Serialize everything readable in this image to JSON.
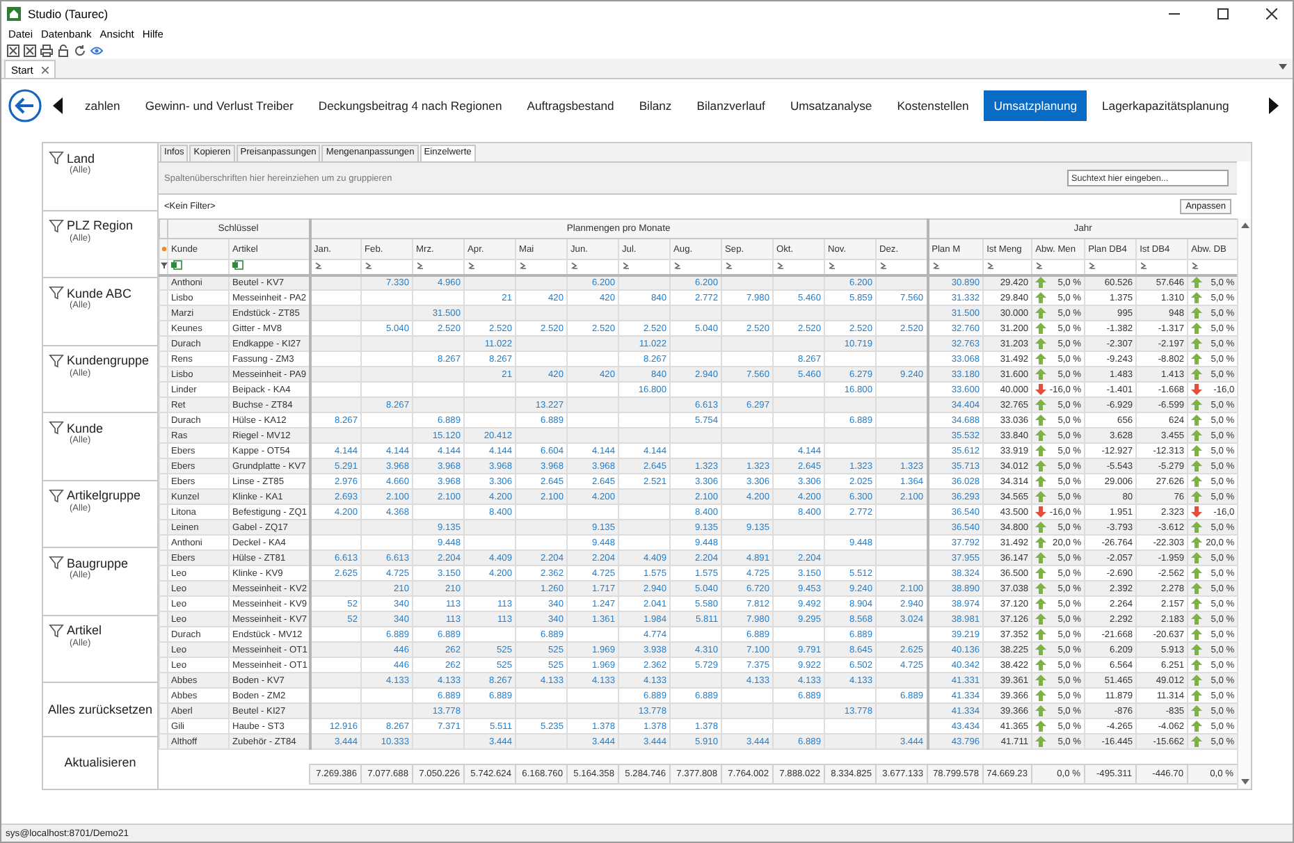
{
  "window": {
    "title": "Studio (Taurec)"
  },
  "menu": [
    "Datei",
    "Datenbank",
    "Ansicht",
    "Hilfe"
  ],
  "doc_tabs": [
    {
      "label": "Start",
      "selected": true
    }
  ],
  "nav_tabs": [
    {
      "label": "zahlen",
      "selected": false
    },
    {
      "label": "Gewinn- und Verlust Treiber",
      "selected": false
    },
    {
      "label": "Deckungsbeitrag 4 nach Regionen",
      "selected": false
    },
    {
      "label": "Auftragsbestand",
      "selected": false
    },
    {
      "label": "Bilanz",
      "selected": false
    },
    {
      "label": "Bilanzverlauf",
      "selected": false
    },
    {
      "label": "Umsatzanalyse",
      "selected": false
    },
    {
      "label": "Kostenstellen",
      "selected": false
    },
    {
      "label": "Umsatzplanung",
      "selected": true
    },
    {
      "label": "Lagerkapazitätsplanung",
      "selected": false
    }
  ],
  "filters": [
    {
      "label": "Land",
      "value": "(Alle)"
    },
    {
      "label": "PLZ Region",
      "value": "(Alle)"
    },
    {
      "label": "Kunde ABC",
      "value": "(Alle)"
    },
    {
      "label": "Kundengruppe",
      "value": "(Alle)"
    },
    {
      "label": "Kunde",
      "value": "(Alle)"
    },
    {
      "label": "Artikelgruppe",
      "value": "(Alle)"
    },
    {
      "label": "Baugruppe",
      "value": "(Alle)"
    },
    {
      "label": "Artikel",
      "value": "(Alle)"
    }
  ],
  "actions": [
    "Alles zurücksetzen",
    "Aktualisieren"
  ],
  "sub_tabs": [
    {
      "label": "Infos",
      "selected": false
    },
    {
      "label": "Kopieren",
      "selected": false
    },
    {
      "label": "Preisanpassungen",
      "selected": false
    },
    {
      "label": "Mengenanpassungen",
      "selected": false
    },
    {
      "label": "Einzelwerte",
      "selected": true
    }
  ],
  "group_hint": "Spaltenüberschriften hier hereinziehen um zu gruppieren",
  "search": {
    "placeholder": "Suchtext hier eingeben..."
  },
  "filter_text": "<Kein Filter>",
  "customize_button": "Anpassen",
  "grid": {
    "bands": [
      {
        "label": "Schlüssel",
        "columns": [
          "Kunde",
          "Artikel"
        ]
      },
      {
        "label": "Planmengen pro Monate",
        "columns": [
          "Jan.",
          "Feb.",
          "Mrz.",
          "Apr.",
          "Mai",
          "Jun.",
          "Jul.",
          "Aug.",
          "Sep.",
          "Okt.",
          "Nov.",
          "Dez."
        ]
      },
      {
        "label": "Jahr",
        "columns": [
          "Plan M",
          "Ist Meng",
          "Abw. Men",
          "Plan DB4",
          "Ist DB4",
          "Abw. DB"
        ]
      }
    ],
    "rows": [
      {
        "kunde": "Anthoni",
        "artikel": "Beutel - KV7",
        "months": {
          "feb": "7.330",
          "mrz": "4.960",
          "jun": "6.200",
          "aug": "6.200",
          "nov": "6.200"
        },
        "plan": "30.890",
        "ist": "29.420",
        "abw_menge": "5,0 %",
        "menge_up": true,
        "plan_db4": "60.526",
        "ist_db4": "57.646",
        "abw_db": "5,0 %",
        "db_up": true
      },
      {
        "kunde": "Lisbo",
        "artikel": "Messeinheit - PA2",
        "months": {
          "apr": "21",
          "mai": "420",
          "jun": "420",
          "jul": "840",
          "aug": "2.772",
          "sep": "7.980",
          "okt": "5.460",
          "nov": "5.859",
          "dez": "7.560"
        },
        "plan": "31.332",
        "ist": "29.840",
        "abw_menge": "5,0 %",
        "menge_up": true,
        "plan_db4": "1.375",
        "ist_db4": "1.310",
        "abw_db": "5,0 %",
        "db_up": true
      },
      {
        "kunde": "Marzi",
        "artikel": "Endstück - ZT85",
        "months": {
          "mrz": "31.500"
        },
        "plan": "31.500",
        "ist": "30.000",
        "abw_menge": "5,0 %",
        "menge_up": true,
        "plan_db4": "995",
        "ist_db4": "948",
        "abw_db": "5,0 %",
        "db_up": true
      },
      {
        "kunde": "Keunes",
        "artikel": "Gitter - MV8",
        "months": {
          "feb": "5.040",
          "mrz": "2.520",
          "apr": "2.520",
          "mai": "2.520",
          "jun": "2.520",
          "jul": "2.520",
          "aug": "5.040",
          "sep": "2.520",
          "okt": "2.520",
          "nov": "2.520",
          "dez": "2.520"
        },
        "plan": "32.760",
        "ist": "31.200",
        "abw_menge": "5,0 %",
        "menge_up": true,
        "plan_db4": "-1.382",
        "ist_db4": "-1.317",
        "abw_db": "5,0 %",
        "db_up": true
      },
      {
        "kunde": "Durach",
        "artikel": "Endkappe - KI27",
        "months": {
          "apr": "11.022",
          "jul": "11.022",
          "nov": "10.719"
        },
        "plan": "32.763",
        "ist": "31.203",
        "abw_menge": "5,0 %",
        "menge_up": true,
        "plan_db4": "-2.307",
        "ist_db4": "-2.197",
        "abw_db": "5,0 %",
        "db_up": true
      },
      {
        "kunde": "Rens",
        "artikel": "Fassung - ZM3",
        "months": {
          "mrz": "8.267",
          "apr": "8.267",
          "jul": "8.267",
          "okt": "8.267"
        },
        "plan": "33.068",
        "ist": "31.492",
        "abw_menge": "5,0 %",
        "menge_up": true,
        "plan_db4": "-9.243",
        "ist_db4": "-8.802",
        "abw_db": "5,0 %",
        "db_up": true
      },
      {
        "kunde": "Lisbo",
        "artikel": "Messeinheit - PA9",
        "months": {
          "apr": "21",
          "mai": "420",
          "jun": "420",
          "jul": "840",
          "aug": "2.940",
          "sep": "7.560",
          "okt": "5.460",
          "nov": "6.279",
          "dez": "9.240"
        },
        "plan": "33.180",
        "ist": "31.600",
        "abw_menge": "5,0 %",
        "menge_up": true,
        "plan_db4": "1.483",
        "ist_db4": "1.413",
        "abw_db": "5,0 %",
        "db_up": true
      },
      {
        "kunde": "Linder",
        "artikel": "Beipack - KA4",
        "months": {
          "jul": "16.800",
          "nov": "16.800"
        },
        "plan": "33.600",
        "ist": "40.000",
        "abw_menge": "-16,0 %",
        "menge_up": false,
        "plan_db4": "-1.401",
        "ist_db4": "-1.668",
        "abw_db": "-16,0",
        "db_up": false
      },
      {
        "kunde": "Ret",
        "artikel": "Buchse - ZT84",
        "months": {
          "feb": "8.267",
          "mai": "13.227",
          "aug": "6.613",
          "sep": "6.297"
        },
        "plan": "34.404",
        "ist": "32.765",
        "abw_menge": "5,0 %",
        "menge_up": true,
        "plan_db4": "-6.929",
        "ist_db4": "-6.599",
        "abw_db": "5,0 %",
        "db_up": true
      },
      {
        "kunde": "Durach",
        "artikel": "Hülse - KA12",
        "months": {
          "jan": "8.267",
          "mrz": "6.889",
          "mai": "6.889",
          "aug": "5.754",
          "nov": "6.889"
        },
        "plan": "34.688",
        "ist": "33.036",
        "abw_menge": "5,0 %",
        "menge_up": true,
        "plan_db4": "656",
        "ist_db4": "624",
        "abw_db": "5,0 %",
        "db_up": true
      },
      {
        "kunde": "Ras",
        "artikel": "Riegel - MV12",
        "months": {
          "mrz": "15.120",
          "apr": "20.412"
        },
        "plan": "35.532",
        "ist": "33.840",
        "abw_menge": "5,0 %",
        "menge_up": true,
        "plan_db4": "3.628",
        "ist_db4": "3.455",
        "abw_db": "5,0 %",
        "db_up": true
      },
      {
        "kunde": "Ebers",
        "artikel": "Kappe - OT54",
        "months": {
          "jan": "4.144",
          "feb": "4.144",
          "mrz": "4.144",
          "apr": "4.144",
          "mai": "6.604",
          "jun": "4.144",
          "jul": "4.144",
          "okt": "4.144"
        },
        "plan": "35.612",
        "ist": "33.919",
        "abw_menge": "5,0 %",
        "menge_up": true,
        "plan_db4": "-12.927",
        "ist_db4": "-12.313",
        "abw_db": "5,0 %",
        "db_up": true
      },
      {
        "kunde": "Ebers",
        "artikel": "Grundplatte - KV7",
        "months": {
          "jan": "5.291",
          "feb": "3.968",
          "mrz": "3.968",
          "apr": "3.968",
          "mai": "3.968",
          "jun": "3.968",
          "jul": "2.645",
          "aug": "1.323",
          "sep": "1.323",
          "okt": "2.645",
          "nov": "1.323",
          "dez": "1.323"
        },
        "plan": "35.713",
        "ist": "34.012",
        "abw_menge": "5,0 %",
        "menge_up": true,
        "plan_db4": "-5.543",
        "ist_db4": "-5.279",
        "abw_db": "5,0 %",
        "db_up": true
      },
      {
        "kunde": "Ebers",
        "artikel": "Linse - ZT85",
        "months": {
          "jan": "2.976",
          "feb": "4.660",
          "mrz": "3.968",
          "apr": "3.306",
          "mai": "2.645",
          "jun": "2.645",
          "jul": "2.521",
          "aug": "3.306",
          "sep": "3.306",
          "okt": "3.306",
          "nov": "2.025",
          "dez": "1.364"
        },
        "plan": "36.028",
        "ist": "34.314",
        "abw_menge": "5,0 %",
        "menge_up": true,
        "plan_db4": "29.006",
        "ist_db4": "27.626",
        "abw_db": "5,0 %",
        "db_up": true
      },
      {
        "kunde": "Kunzel",
        "artikel": "Klinke - KA1",
        "months": {
          "jan": "2.693",
          "feb": "2.100",
          "mrz": "2.100",
          "apr": "4.200",
          "mai": "2.100",
          "jun": "4.200",
          "aug": "2.100",
          "sep": "4.200",
          "okt": "4.200",
          "nov": "6.300",
          "dez": "2.100"
        },
        "plan": "36.293",
        "ist": "34.565",
        "abw_menge": "5,0 %",
        "menge_up": true,
        "plan_db4": "80",
        "ist_db4": "76",
        "abw_db": "5,0 %",
        "db_up": true
      },
      {
        "kunde": "Litona",
        "artikel": "Befestigung - ZQ1",
        "months": {
          "jan": "4.200",
          "feb": "4.368",
          "apr": "8.400",
          "aug": "8.400",
          "okt": "8.400",
          "nov": "2.772"
        },
        "plan": "36.540",
        "ist": "43.500",
        "abw_menge": "-16,0 %",
        "menge_up": false,
        "plan_db4": "1.951",
        "ist_db4": "2.323",
        "abw_db": "-16,0",
        "db_up": false
      },
      {
        "kunde": "Leinen",
        "artikel": "Gabel - ZQ17",
        "months": {
          "mrz": "9.135",
          "jun": "9.135",
          "aug": "9.135",
          "sep": "9.135"
        },
        "plan": "36.540",
        "ist": "34.800",
        "abw_menge": "5,0 %",
        "menge_up": true,
        "plan_db4": "-3.793",
        "ist_db4": "-3.612",
        "abw_db": "5,0 %",
        "db_up": true
      },
      {
        "kunde": "Anthoni",
        "artikel": "Deckel - KA4",
        "months": {
          "mrz": "9.448",
          "jun": "9.448",
          "aug": "9.448",
          "nov": "9.448"
        },
        "plan": "37.792",
        "ist": "31.492",
        "abw_menge": "20,0 %",
        "menge_up": true,
        "plan_db4": "-26.764",
        "ist_db4": "-22.303",
        "abw_db": "20,0 %",
        "db_up": true
      },
      {
        "kunde": "Ebers",
        "artikel": "Hülse - ZT81",
        "months": {
          "jan": "6.613",
          "feb": "6.613",
          "mrz": "2.204",
          "apr": "4.409",
          "mai": "2.204",
          "jun": "2.204",
          "jul": "4.409",
          "aug": "2.204",
          "sep": "4.891",
          "okt": "2.204"
        },
        "plan": "37.955",
        "ist": "36.147",
        "abw_menge": "5,0 %",
        "menge_up": true,
        "plan_db4": "-2.057",
        "ist_db4": "-1.959",
        "abw_db": "5,0 %",
        "db_up": true
      },
      {
        "kunde": "Leo",
        "artikel": "Klinke - KV9",
        "months": {
          "jan": "2.625",
          "feb": "4.725",
          "mrz": "3.150",
          "apr": "4.200",
          "mai": "2.362",
          "jun": "4.725",
          "jul": "1.575",
          "aug": "1.575",
          "sep": "4.725",
          "okt": "3.150",
          "nov": "5.512"
        },
        "plan": "38.324",
        "ist": "36.500",
        "abw_menge": "5,0 %",
        "menge_up": true,
        "plan_db4": "-2.690",
        "ist_db4": "-2.562",
        "abw_db": "5,0 %",
        "db_up": true
      },
      {
        "kunde": "Leo",
        "artikel": "Messeinheit - KV2",
        "months": {
          "feb": "210",
          "mrz": "210",
          "mai": "1.260",
          "jun": "1.717",
          "jul": "2.940",
          "aug": "5.040",
          "sep": "6.720",
          "okt": "9.453",
          "nov": "9.240",
          "dez": "2.100"
        },
        "plan": "38.890",
        "ist": "37.038",
        "abw_menge": "5,0 %",
        "menge_up": true,
        "plan_db4": "2.392",
        "ist_db4": "2.278",
        "abw_db": "5,0 %",
        "db_up": true
      },
      {
        "kunde": "Leo",
        "artikel": "Messeinheit - KV9",
        "months": {
          "jan": "52",
          "feb": "340",
          "mrz": "113",
          "apr": "113",
          "mai": "340",
          "jun": "1.247",
          "jul": "2.041",
          "aug": "5.580",
          "sep": "7.812",
          "okt": "9.492",
          "nov": "8.904",
          "dez": "2.940"
        },
        "plan": "38.974",
        "ist": "37.120",
        "abw_menge": "5,0 %",
        "menge_up": true,
        "plan_db4": "2.264",
        "ist_db4": "2.157",
        "abw_db": "5,0 %",
        "db_up": true
      },
      {
        "kunde": "Leo",
        "artikel": "Messeinheit - KV7",
        "months": {
          "jan": "52",
          "feb": "340",
          "mrz": "113",
          "apr": "113",
          "mai": "340",
          "jun": "1.361",
          "jul": "1.984",
          "aug": "5.811",
          "sep": "7.980",
          "okt": "9.295",
          "nov": "8.568",
          "dez": "3.024"
        },
        "plan": "38.981",
        "ist": "37.126",
        "abw_menge": "5,0 %",
        "menge_up": true,
        "plan_db4": "2.292",
        "ist_db4": "2.183",
        "abw_db": "5,0 %",
        "db_up": true
      },
      {
        "kunde": "Durach",
        "artikel": "Endstück - MV12",
        "months": {
          "feb": "6.889",
          "mrz": "6.889",
          "mai": "6.889",
          "jul": "4.774",
          "sep": "6.889",
          "nov": "6.889"
        },
        "plan": "39.219",
        "ist": "37.352",
        "abw_menge": "5,0 %",
        "menge_up": true,
        "plan_db4": "-21.668",
        "ist_db4": "-20.637",
        "abw_db": "5,0 %",
        "db_up": true
      },
      {
        "kunde": "Leo",
        "artikel": "Messeinheit - OT1",
        "months": {
          "feb": "446",
          "mrz": "262",
          "apr": "525",
          "mai": "525",
          "jun": "1.969",
          "jul": "3.938",
          "aug": "4.310",
          "sep": "7.100",
          "okt": "9.791",
          "nov": "8.645",
          "dez": "2.625"
        },
        "plan": "40.136",
        "ist": "38.225",
        "abw_menge": "5,0 %",
        "menge_up": true,
        "plan_db4": "6.209",
        "ist_db4": "5.913",
        "abw_db": "5,0 %",
        "db_up": true
      },
      {
        "kunde": "Leo",
        "artikel": "Messeinheit - OT1",
        "months": {
          "feb": "446",
          "mrz": "262",
          "apr": "525",
          "mai": "525",
          "jun": "1.969",
          "jul": "2.362",
          "aug": "5.729",
          "sep": "7.375",
          "okt": "9.922",
          "nov": "6.502",
          "dez": "4.725"
        },
        "plan": "40.342",
        "ist": "38.422",
        "abw_menge": "5,0 %",
        "menge_up": true,
        "plan_db4": "6.564",
        "ist_db4": "6.251",
        "abw_db": "5,0 %",
        "db_up": true
      },
      {
        "kunde": "Abbes",
        "artikel": "Boden - KV7",
        "months": {
          "feb": "4.133",
          "mrz": "4.133",
          "apr": "8.267",
          "mai": "4.133",
          "jun": "4.133",
          "jul": "4.133",
          "sep": "4.133",
          "okt": "4.133",
          "nov": "4.133"
        },
        "plan": "41.331",
        "ist": "39.361",
        "abw_menge": "5,0 %",
        "menge_up": true,
        "plan_db4": "51.465",
        "ist_db4": "49.012",
        "abw_db": "5,0 %",
        "db_up": true
      },
      {
        "kunde": "Abbes",
        "artikel": "Boden - ZM2",
        "months": {
          "mrz": "6.889",
          "apr": "6.889",
          "jul": "6.889",
          "aug": "6.889",
          "okt": "6.889",
          "dez": "6.889"
        },
        "plan": "41.334",
        "ist": "39.366",
        "abw_menge": "5,0 %",
        "menge_up": true,
        "plan_db4": "11.879",
        "ist_db4": "11.314",
        "abw_db": "5,0 %",
        "db_up": true
      },
      {
        "kunde": "Aberl",
        "artikel": "Beutel - KI27",
        "months": {
          "mrz": "13.778",
          "jul": "13.778",
          "nov": "13.778"
        },
        "plan": "41.334",
        "ist": "39.366",
        "abw_menge": "5,0 %",
        "menge_up": true,
        "plan_db4": "-876",
        "ist_db4": "-835",
        "abw_db": "5,0 %",
        "db_up": true
      },
      {
        "kunde": "Gili",
        "artikel": "Haube - ST3",
        "months": {
          "jan": "12.916",
          "feb": "8.267",
          "mrz": "7.371",
          "apr": "5.511",
          "mai": "5.235",
          "jun": "1.378",
          "jul": "1.378",
          "aug": "1.378"
        },
        "plan": "43.434",
        "ist": "41.365",
        "abw_menge": "5,0 %",
        "menge_up": true,
        "plan_db4": "-4.265",
        "ist_db4": "-4.062",
        "abw_db": "5,0 %",
        "db_up": true
      },
      {
        "kunde": "Althoff",
        "artikel": "Zubehör - ZT84",
        "months": {
          "jan": "3.444",
          "feb": "10.333",
          "apr": "3.444",
          "jun": "3.444",
          "jul": "3.444",
          "aug": "5.910",
          "sep": "3.444",
          "okt": "6.889",
          "dez": "3.444"
        },
        "plan": "43.796",
        "ist": "41.711",
        "abw_menge": "5,0 %",
        "menge_up": true,
        "plan_db4": "-16.445",
        "ist_db4": "-15.662",
        "abw_db": "5,0 %",
        "db_up": true
      }
    ],
    "totals": [
      "7.269.386",
      "7.077.688",
      "7.050.226",
      "5.742.624",
      "6.168.760",
      "5.164.358",
      "5.284.746",
      "7.377.808",
      "7.764.002",
      "7.888.022",
      "8.334.825",
      "3.677.133",
      "78.799.578",
      "74.669.23",
      "0,0 %",
      "-495.311",
      "-446.70",
      "0,0 %"
    ]
  },
  "status_bar": "sys@localhost:8701/Demo21"
}
